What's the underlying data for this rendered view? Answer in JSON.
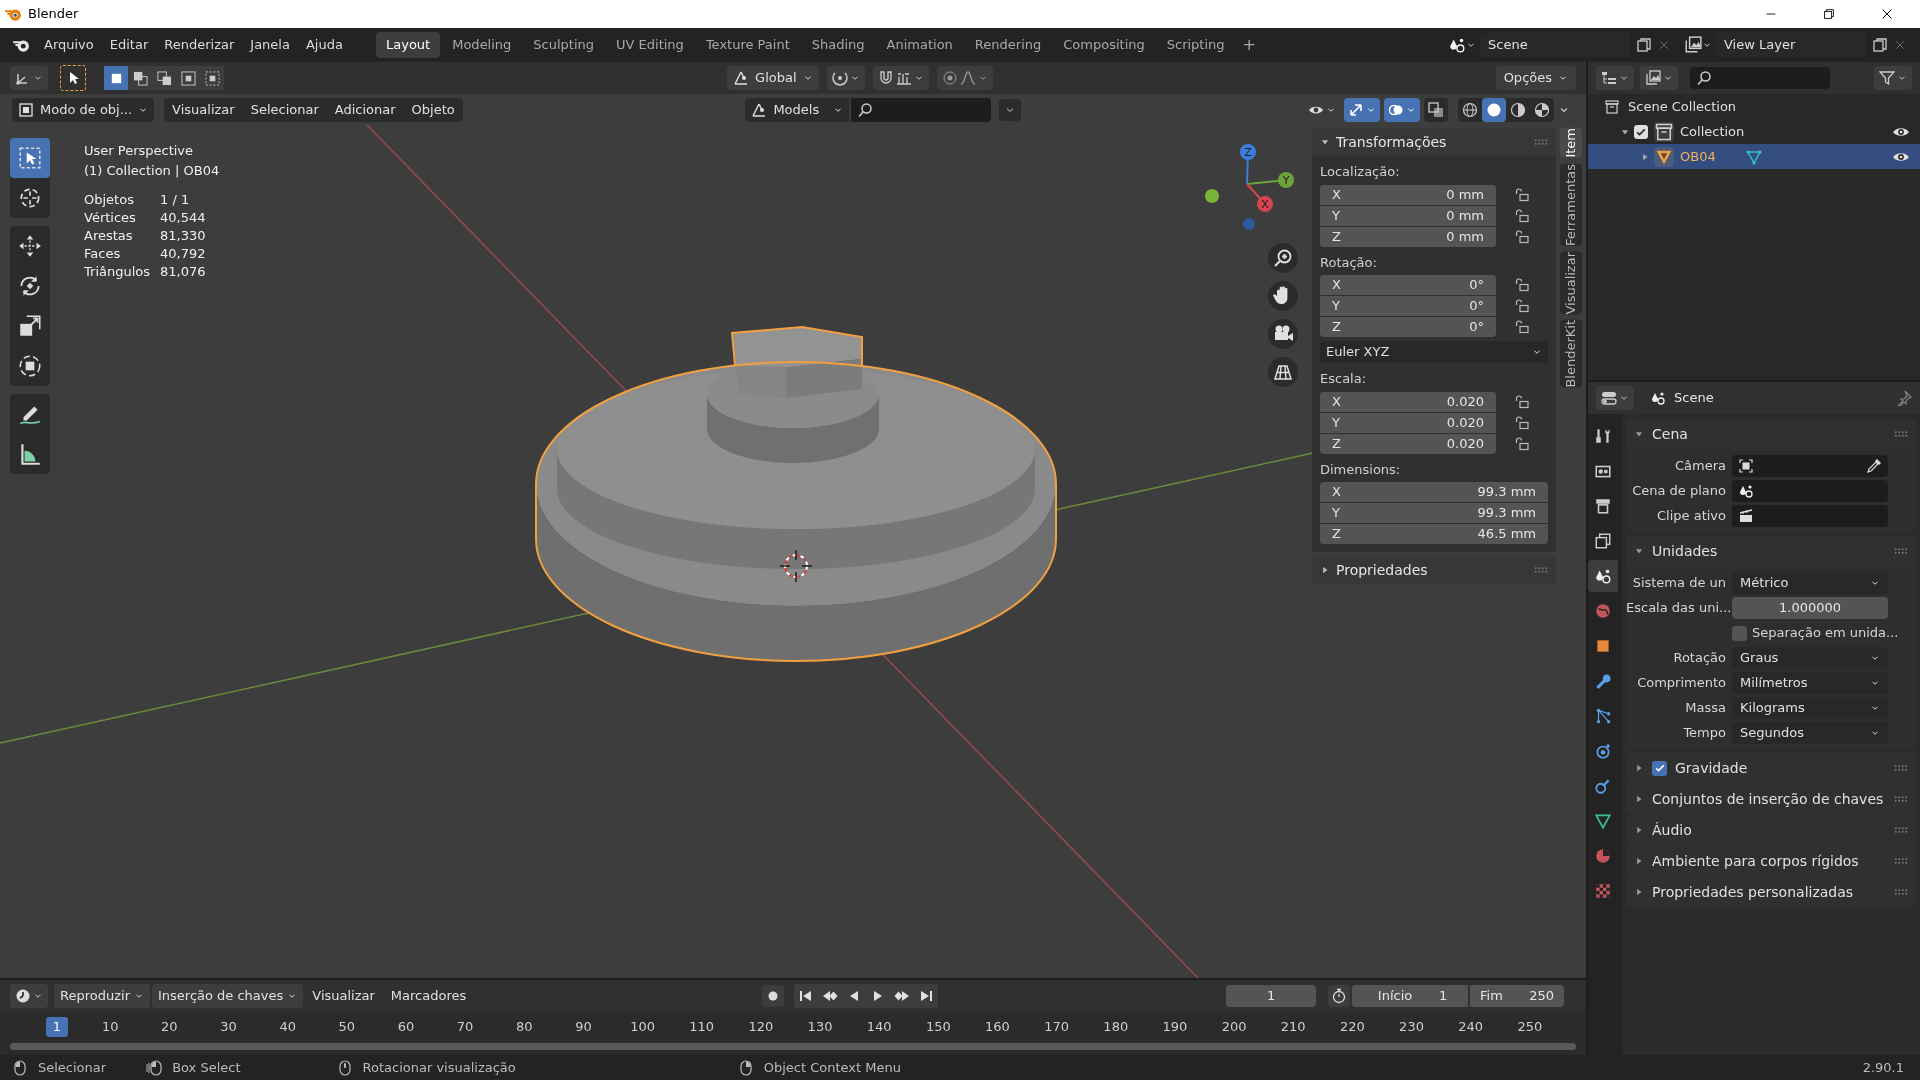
{
  "title_bar": {
    "title": "Blender"
  },
  "menu": [
    "Arquivo",
    "Editar",
    "Renderizar",
    "Janela",
    "Ajuda"
  ],
  "workspaces": [
    {
      "label": "Layout",
      "selected": true
    },
    {
      "label": "Modeling",
      "selected": false
    },
    {
      "label": "Sculpting",
      "selected": false
    },
    {
      "label": "UV Editing",
      "selected": false
    },
    {
      "label": "Texture Paint",
      "selected": false
    },
    {
      "label": "Shading",
      "selected": false
    },
    {
      "label": "Animation",
      "selected": false
    },
    {
      "label": "Rendering",
      "selected": false
    },
    {
      "label": "Compositing",
      "selected": false
    },
    {
      "label": "Scripting",
      "selected": false
    }
  ],
  "add_workspace": "+",
  "scene": {
    "value": "Scene"
  },
  "view_layer": {
    "value": "View Layer"
  },
  "viewport_header": {
    "select_modes": [
      {
        "selected": true
      },
      {
        "selected": false
      },
      {
        "selected": false
      },
      {
        "selected": false
      },
      {
        "selected": false
      }
    ],
    "orientation": "Global",
    "options": "Opções",
    "mode": "Modo de obj...",
    "menus": [
      "Visualizar",
      "Selecionar",
      "Adicionar",
      "Objeto"
    ],
    "collection": "Models",
    "toggles": [
      {
        "kind": "gizmos",
        "on": true
      },
      {
        "kind": "overlays",
        "on": true
      },
      {
        "kind": "xray",
        "on": false
      }
    ],
    "shading": [
      {
        "kind": "wireframe",
        "selected": false
      },
      {
        "kind": "solid",
        "selected": true
      },
      {
        "kind": "material",
        "selected": false
      },
      {
        "kind": "rendered",
        "selected": false
      }
    ]
  },
  "toolbar": [
    {
      "tools": [
        {
          "kind": "select",
          "selected": true
        },
        {
          "kind": "cursor",
          "selected": false
        }
      ]
    },
    {
      "tools": [
        {
          "kind": "move",
          "selected": false
        },
        {
          "kind": "rotate",
          "selected": false
        },
        {
          "kind": "scale",
          "selected": false
        },
        {
          "kind": "transform",
          "selected": false
        }
      ]
    },
    {
      "tools": [
        {
          "kind": "annotate",
          "selected": false
        },
        {
          "kind": "measure",
          "selected": false
        }
      ]
    }
  ],
  "viewport_info": {
    "view": "User Perspective",
    "context": "(1) Collection | OB04",
    "stats": [
      {
        "label": "Objetos",
        "value": "1 / 1"
      },
      {
        "label": "Vértices",
        "value": "40,544"
      },
      {
        "label": "Arestas",
        "value": "81,330"
      },
      {
        "label": "Faces",
        "value": "40,792"
      },
      {
        "label": "Triângulos",
        "value": "81,076"
      }
    ]
  },
  "gizmo": {
    "axes": [
      "Z",
      "Y",
      "X"
    ]
  },
  "sidebar": {
    "tabs": [
      {
        "label": "Item",
        "selected": true
      },
      {
        "label": "Ferramentas",
        "selected": false
      },
      {
        "label": "Visualizar",
        "selected": false
      },
      {
        "label": "BlenderKit",
        "selected": false
      }
    ],
    "panels": [
      {
        "title": "Transformações",
        "expanded": true,
        "groups": [
          {
            "kind": "locked-vector",
            "label": "Localização:",
            "fields": [
              {
                "axis": "X",
                "value": "0 mm",
                "locked": false
              },
              {
                "axis": "Y",
                "value": "0 mm",
                "locked": false
              },
              {
                "axis": "Z",
                "value": "0 mm",
                "locked": false
              }
            ]
          },
          {
            "kind": "locked-vector",
            "label": "Rotação:",
            "fields": [
              {
                "axis": "X",
                "value": "0°",
                "locked": false
              },
              {
                "axis": "Y",
                "value": "0°",
                "locked": false
              },
              {
                "axis": "Z",
                "value": "0°",
                "locked": false
              }
            ]
          },
          {
            "kind": "dropdown",
            "value": "Euler XYZ"
          },
          {
            "kind": "locked-vector",
            "label": "Escala:",
            "fields": [
              {
                "axis": "X",
                "value": "0.020",
                "locked": false
              },
              {
                "axis": "Y",
                "value": "0.020",
                "locked": false
              },
              {
                "axis": "Z",
                "value": "0.020",
                "locked": false
              }
            ]
          },
          {
            "kind": "vector",
            "label": "Dimensions:",
            "fields": [
              {
                "axis": "X",
                "value": "99.3 mm"
              },
              {
                "axis": "Y",
                "value": "99.3 mm"
              },
              {
                "axis": "Z",
                "value": "46.5 mm"
              }
            ]
          }
        ]
      },
      {
        "title": "Propriedades",
        "expanded": false
      }
    ]
  },
  "outliner": {
    "tree": [
      {
        "label": "Scene Collection",
        "kind": "scene-collection",
        "children": [
          {
            "label": "Collection",
            "kind": "collection",
            "checked": true,
            "expanded": true,
            "visible": true,
            "children": [
              {
                "label": "OB04",
                "kind": "mesh-object",
                "expanded": false,
                "selected": true,
                "visible": true
              }
            ]
          }
        ]
      }
    ]
  },
  "properties": {
    "context": "Scene",
    "tabs": [
      {
        "kind": "tool",
        "selected": false
      },
      {
        "kind": "render",
        "selected": false
      },
      {
        "kind": "output",
        "selected": false
      },
      {
        "kind": "view-layer",
        "selected": false
      },
      {
        "kind": "scene",
        "selected": true
      },
      {
        "kind": "world",
        "selected": false
      },
      {
        "kind": "object",
        "selected": false
      },
      {
        "kind": "modifier",
        "selected": false
      },
      {
        "kind": "particles",
        "selected": false
      },
      {
        "kind": "physics",
        "selected": false
      },
      {
        "kind": "constraints",
        "selected": false
      },
      {
        "kind": "data",
        "selected": false
      },
      {
        "kind": "material",
        "selected": false
      },
      {
        "kind": "texture",
        "selected": false
      }
    ],
    "panels": [
      {
        "title": "Cena",
        "expanded": true,
        "rows": [
          {
            "kind": "camera-picker",
            "label": "Câmera"
          },
          {
            "kind": "scene-picker",
            "label": "Cena de plano"
          },
          {
            "kind": "clip-picker",
            "label": "Clipe ativo"
          }
        ]
      },
      {
        "title": "Unidades",
        "expanded": true,
        "rows": [
          {
            "kind": "dropdown",
            "label": "Sistema de un",
            "value": "Métrico"
          },
          {
            "kind": "number",
            "label": "Escala das uni...",
            "value": "1.000000"
          },
          {
            "kind": "checkbox",
            "label": "Separação em unida...",
            "checked": false
          },
          {
            "kind": "dropdown",
            "label": "Rotação",
            "value": "Graus"
          },
          {
            "kind": "dropdown",
            "label": "Comprimento",
            "value": "Milímetros"
          },
          {
            "kind": "dropdown",
            "label": "Massa",
            "value": "Kilograms"
          },
          {
            "kind": "dropdown",
            "label": "Tempo",
            "value": "Segundos"
          }
        ]
      },
      {
        "title": "Gravidade",
        "expanded": false,
        "checked": true
      },
      {
        "title": "Conjuntos de inserção de chaves",
        "expanded": false
      },
      {
        "title": "Áudio",
        "expanded": false
      },
      {
        "title": "Ambiente para corpos rígidos",
        "expanded": false
      },
      {
        "title": "Propriedades personalizadas",
        "expanded": false
      }
    ]
  },
  "timeline": {
    "menus": [
      {
        "label": "Reproduzir",
        "kind": "dropdown"
      },
      {
        "label": "Inserção de chaves",
        "kind": "dropdown"
      },
      {
        "label": "Visualizar",
        "kind": "menu"
      },
      {
        "label": "Marcadores",
        "kind": "menu"
      }
    ],
    "current_frame": "1",
    "start": {
      "label": "Início",
      "value": "1"
    },
    "end": {
      "label": "Fim",
      "value": "250"
    },
    "ruler": [
      {
        "label": "1",
        "selected": true
      },
      {
        "label": "10",
        "selected": false
      },
      {
        "label": "20",
        "selected": false
      },
      {
        "label": "30",
        "selected": false
      },
      {
        "label": "40",
        "selected": false
      },
      {
        "label": "50",
        "selected": false
      },
      {
        "label": "60",
        "selected": false
      },
      {
        "label": "70",
        "selected": false
      },
      {
        "label": "80",
        "selected": false
      },
      {
        "label": "90",
        "selected": false
      },
      {
        "label": "100",
        "selected": false
      },
      {
        "label": "110",
        "selected": false
      },
      {
        "label": "120",
        "selected": false
      },
      {
        "label": "130",
        "selected": false
      },
      {
        "label": "140",
        "selected": false
      },
      {
        "label": "150",
        "selected": false
      },
      {
        "label": "160",
        "selected": false
      },
      {
        "label": "170",
        "selected": false
      },
      {
        "label": "180",
        "selected": false
      },
      {
        "label": "190",
        "selected": false
      },
      {
        "label": "200",
        "selected": false
      },
      {
        "label": "210",
        "selected": false
      },
      {
        "label": "220",
        "selected": false
      },
      {
        "label": "230",
        "selected": false
      },
      {
        "label": "240",
        "selected": false
      },
      {
        "label": "250",
        "selected": false
      }
    ]
  },
  "status_bar": {
    "hints": [
      {
        "kind": "left-click",
        "label": "Selecionar"
      },
      {
        "kind": "drag",
        "label": "Box Select"
      },
      {
        "kind": "middle-click",
        "label": "Rotacionar visualização"
      },
      {
        "kind": "right-click",
        "label": "Object Context Menu"
      }
    ],
    "version": "2.90.1"
  }
}
